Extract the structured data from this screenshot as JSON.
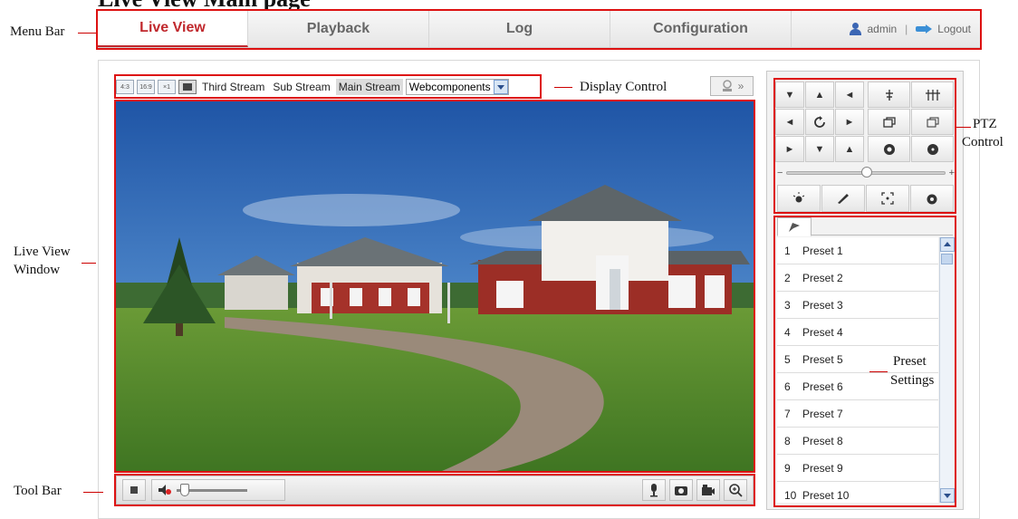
{
  "heading": "Live View Main page",
  "menu": {
    "tabs": [
      {
        "label": "Live View"
      },
      {
        "label": "Playback"
      },
      {
        "label": "Log"
      },
      {
        "label": "Configuration"
      }
    ],
    "active_tab": "Live View",
    "user": "admin",
    "separator": "|",
    "logout": "Logout"
  },
  "display": {
    "ratio_buttons": [
      "4:3",
      "16:9",
      "×1"
    ],
    "streams": [
      "Third Stream",
      "Sub Stream",
      "Main Stream"
    ],
    "active_stream": "Main Stream",
    "plugin_select": "Webcomponents",
    "toggle_label": "»"
  },
  "toolbar": {
    "volume_level": 0.05
  },
  "ptz": {
    "speed_level": 0.47,
    "speed_min_label": "−",
    "speed_max_label": "+"
  },
  "presets": [
    {
      "num": "1",
      "name": "Preset 1"
    },
    {
      "num": "2",
      "name": "Preset 2"
    },
    {
      "num": "3",
      "name": "Preset 3"
    },
    {
      "num": "4",
      "name": "Preset 4"
    },
    {
      "num": "5",
      "name": "Preset 5"
    },
    {
      "num": "6",
      "name": "Preset 6"
    },
    {
      "num": "7",
      "name": "Preset 7"
    },
    {
      "num": "8",
      "name": "Preset 8"
    },
    {
      "num": "9",
      "name": "Preset 9"
    },
    {
      "num": "10",
      "name": "Preset 10"
    }
  ],
  "annotations": {
    "menu_bar": "Menu Bar",
    "display_control": "Display Control",
    "live_view_window_1": "Live View",
    "live_view_window_2": "Window",
    "tool_bar": "Tool Bar",
    "ptz_1": "PTZ",
    "ptz_2": "Control",
    "preset_1": "Preset",
    "preset_2": "Settings"
  },
  "colors": {
    "active_tab": "#c0282d",
    "annotation_box": "#d11111",
    "sky": "#3a6fb8",
    "grass": "#4f8a2c"
  }
}
